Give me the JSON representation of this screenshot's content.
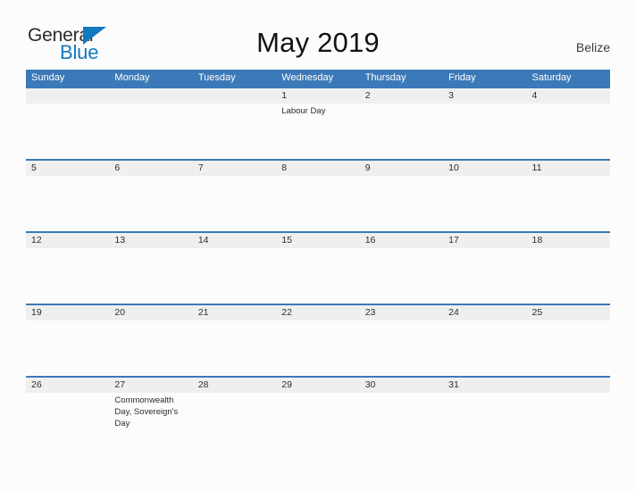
{
  "brand": {
    "name_part1": "General",
    "name_part2": "Blue",
    "triangle_color": "#1279c0",
    "text_color": "#2b2b2b"
  },
  "header": {
    "title": "May 2019",
    "locale": "Belize"
  },
  "theme": {
    "header_blue": "#3b79b8",
    "row_border_blue": "#3b79b8",
    "daynum_band_gray": "#efefef",
    "page_background": "#fcfcfc"
  },
  "calendar": {
    "weekdays": [
      "Sunday",
      "Monday",
      "Tuesday",
      "Wednesday",
      "Thursday",
      "Friday",
      "Saturday"
    ],
    "weeks": [
      {
        "days": [
          {
            "num": "",
            "events": ""
          },
          {
            "num": "",
            "events": ""
          },
          {
            "num": "",
            "events": ""
          },
          {
            "num": "1",
            "events": "Labour Day"
          },
          {
            "num": "2",
            "events": ""
          },
          {
            "num": "3",
            "events": ""
          },
          {
            "num": "4",
            "events": ""
          }
        ]
      },
      {
        "days": [
          {
            "num": "5",
            "events": ""
          },
          {
            "num": "6",
            "events": ""
          },
          {
            "num": "7",
            "events": ""
          },
          {
            "num": "8",
            "events": ""
          },
          {
            "num": "9",
            "events": ""
          },
          {
            "num": "10",
            "events": ""
          },
          {
            "num": "11",
            "events": ""
          }
        ]
      },
      {
        "days": [
          {
            "num": "12",
            "events": ""
          },
          {
            "num": "13",
            "events": ""
          },
          {
            "num": "14",
            "events": ""
          },
          {
            "num": "15",
            "events": ""
          },
          {
            "num": "16",
            "events": ""
          },
          {
            "num": "17",
            "events": ""
          },
          {
            "num": "18",
            "events": ""
          }
        ]
      },
      {
        "days": [
          {
            "num": "19",
            "events": ""
          },
          {
            "num": "20",
            "events": ""
          },
          {
            "num": "21",
            "events": ""
          },
          {
            "num": "22",
            "events": ""
          },
          {
            "num": "23",
            "events": ""
          },
          {
            "num": "24",
            "events": ""
          },
          {
            "num": "25",
            "events": ""
          }
        ]
      },
      {
        "days": [
          {
            "num": "26",
            "events": ""
          },
          {
            "num": "27",
            "events": "Commonwealth Day, Sovereign's Day"
          },
          {
            "num": "28",
            "events": ""
          },
          {
            "num": "29",
            "events": ""
          },
          {
            "num": "30",
            "events": ""
          },
          {
            "num": "31",
            "events": ""
          },
          {
            "num": "",
            "events": ""
          }
        ]
      }
    ]
  }
}
